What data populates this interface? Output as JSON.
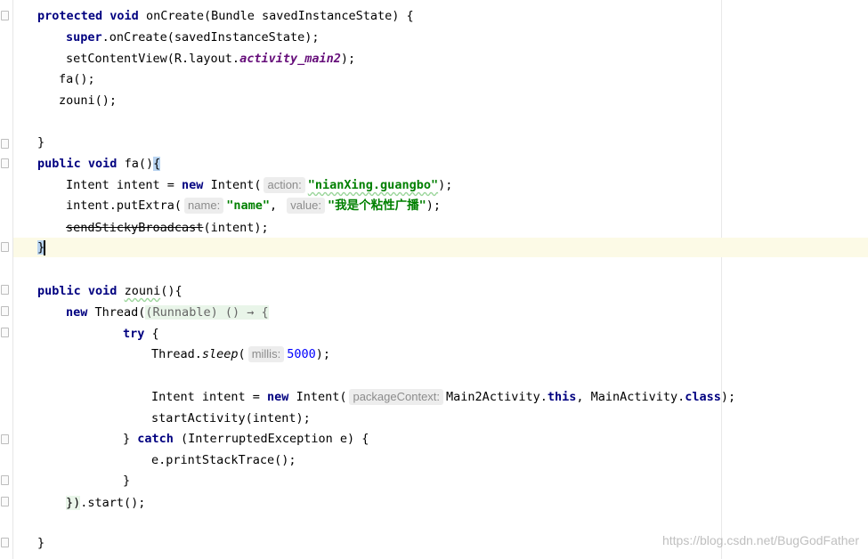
{
  "code": {
    "l1": {
      "kw1": "protected",
      "kw2": "void",
      "rest": " onCreate(Bundle savedInstanceState) {"
    },
    "l2": {
      "kw": "super",
      "rest": ".onCreate(savedInstanceState);"
    },
    "l3": {
      "pre": "setContentView(R.layout.",
      "field": "activity_main2",
      "post": ");"
    },
    "l4": {
      "text": "fa();"
    },
    "l5": {
      "text": "zouni();"
    },
    "l7": {
      "text": "}"
    },
    "l8": {
      "kw1": "public",
      "kw2": "void",
      "rest": " fa()",
      "brace": "{"
    },
    "l9": {
      "pre": "Intent intent = ",
      "kw": "new",
      "mid": " Intent(",
      "hint": "action:",
      "str": "\"nianXing.guangbo\"",
      "post": ");"
    },
    "l10": {
      "pre": "intent.putExtra(",
      "hint1": "name:",
      "str1": "\"name\"",
      "comma": ", ",
      "hint2": "value:",
      "str2": "\"我是个粘性广播\"",
      "post": ");"
    },
    "l11": {
      "strike": "sendStickyBroadcast",
      "post": "(intent);"
    },
    "l12": {
      "brace": "}"
    },
    "l14": {
      "kw1": "public",
      "kw2": "void",
      "name": "zouni",
      "post": "(){"
    },
    "l15": {
      "kw": "new",
      "mid": " Thread(",
      "lambda": "(Runnable) () → {"
    },
    "l16": {
      "kw": "try",
      "post": " {"
    },
    "l17": {
      "pre": "Thread.",
      "method": "sleep",
      "paren": "(",
      "hint": "millis:",
      "num": "5000",
      "post": ");"
    },
    "l19": {
      "pre": "Intent intent = ",
      "kw": "new",
      "mid": " Intent(",
      "hint": "packageContext:",
      "arg": "Main2Activity.",
      "kw2": "this",
      "mid2": ", MainActivity.",
      "kw3": "class",
      "post": ");"
    },
    "l20": {
      "text": "startActivity(intent);"
    },
    "l21": {
      "pre": "} ",
      "kw": "catch",
      "post": " (InterruptedException e) {"
    },
    "l22": {
      "text": "e.printStackTrace();"
    },
    "l23": {
      "text": "}"
    },
    "l24": {
      "lambda_end": "})",
      "post": ".start();"
    },
    "l26": {
      "text": "}"
    }
  },
  "watermark": "https://blog.csdn.net/BugGodFather"
}
